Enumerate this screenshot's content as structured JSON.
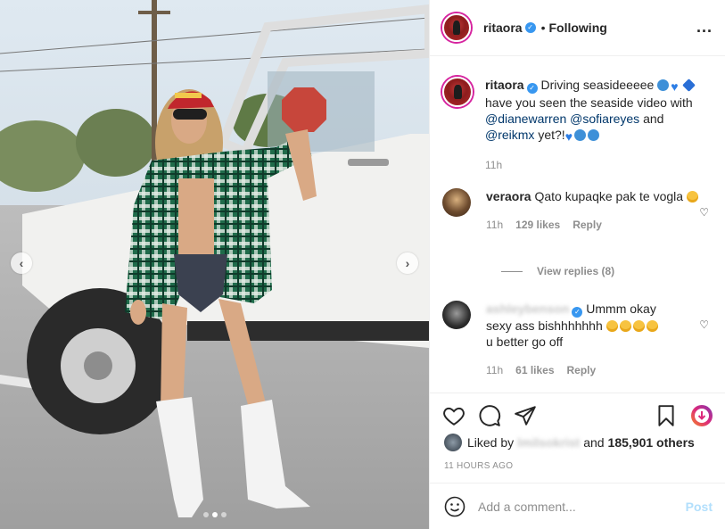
{
  "header": {
    "username": "ritaora",
    "separator": "•",
    "follow_label": "Following",
    "more_label": "..."
  },
  "caption": {
    "username": "ritaora",
    "text_1": "Driving seasideeeee",
    "text_2": "have you seen the seaside video with",
    "mention_1": "@dianewarren",
    "mention_2": "@sofiareyes",
    "and_label": "and",
    "mention_3": "@reikmx",
    "text_3": "yet?!",
    "time": "11h"
  },
  "comments": [
    {
      "username": "veraora",
      "text": "Qato kupaqke pak te vogla",
      "time": "11h",
      "likes": "129 likes",
      "reply_label": "Reply",
      "view_replies": "View replies (8)"
    },
    {
      "username": "ashleybenson",
      "text_1": "Ummm okay",
      "text_2": "sexy ass bishhhhhhh",
      "text_3": "u better go off",
      "time": "11h",
      "likes": "61 likes",
      "reply_label": "Reply"
    }
  ],
  "likes": {
    "prefix": "Liked by",
    "blurred_user": "lmilsokrist",
    "suffix": "and",
    "count": "185,901 others"
  },
  "time_ago": "11 HOURS AGO",
  "add_comment": {
    "placeholder": "Add a comment...",
    "post_label": "Post"
  },
  "carousel": {
    "prev_label": "‹",
    "next_label": "›",
    "slide_count": 3,
    "active_slide": 2
  },
  "colors": {
    "link": "#00376b",
    "muted": "#8e8e8e",
    "verified": "#3897f0",
    "post_disabled": "#b2dffc"
  }
}
